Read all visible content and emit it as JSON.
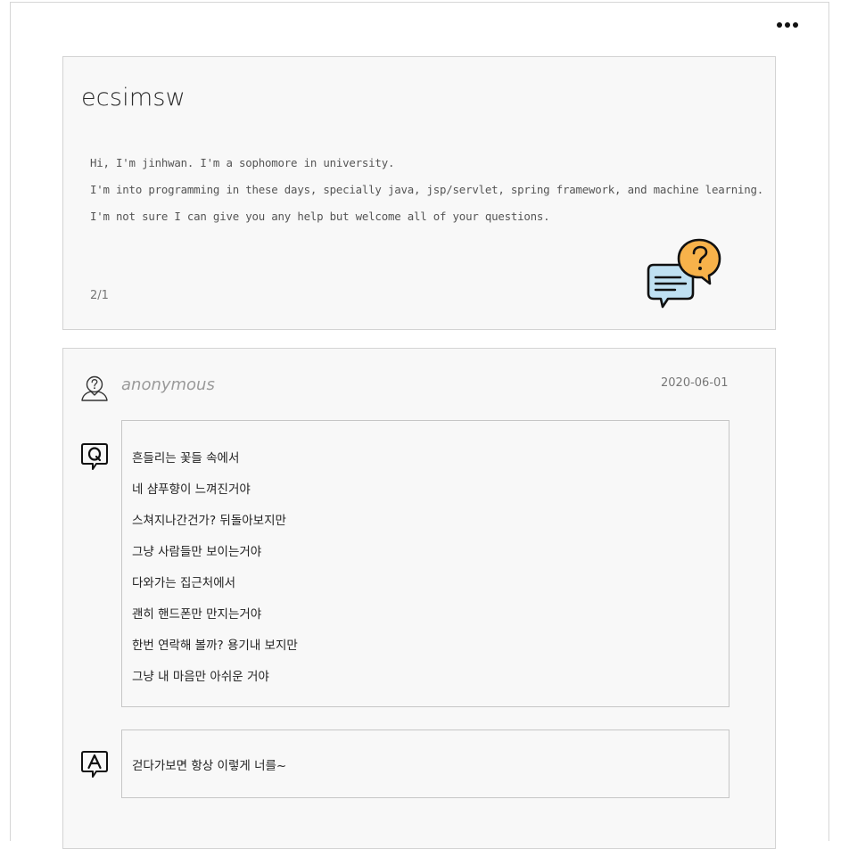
{
  "header": {
    "more_icon": "more-horizontal-icon"
  },
  "profile": {
    "name": "ecsimsw",
    "bio_lines": [
      "Hi, I'm jinhwan. I'm a sophomore in university.",
      "I'm into programming in these days, specially java, jsp/servlet, spring framework, and machine learning.",
      "I'm not sure I can give you any help but welcome all of your questions."
    ],
    "page_indicator": "2/1",
    "illustration_icon": "chat-question-bubbles-icon"
  },
  "qa": {
    "author": "anonymous",
    "author_icon": "anonymous-user-icon",
    "date": "2020-06-01",
    "question_icon": "question-q-icon",
    "answer_icon": "answer-a-icon",
    "question_lines": [
      "흔들리는 꽃들 속에서",
      "네 샴푸향이 느껴진거야",
      "스쳐지나간건가? 뒤돌아보지만",
      "그냥 사람들만 보이는거야",
      "다와가는 집근처에서",
      "괜히 핸드폰만 만지는거야",
      "한번 연락해 볼까? 용기내 보지만",
      "그냥 내 마음만 아쉬운 거야"
    ],
    "answer": "걷다가보면 항상 이렇게 너를~"
  },
  "colors": {
    "card_bg": "#f8f8f8",
    "border": "#d3d3d3",
    "bubble_orange": "#f7b24a",
    "bubble_blue": "#bfe0f2"
  }
}
